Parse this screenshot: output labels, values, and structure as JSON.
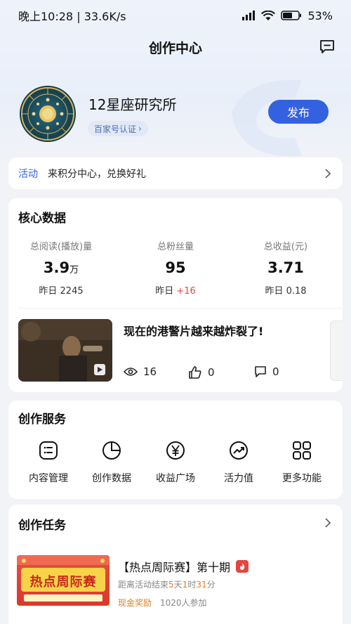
{
  "status_bar": {
    "time": "晚上10:28",
    "speed": "33.6K/s",
    "battery": "53"
  },
  "header": {
    "title": "创作中心"
  },
  "profile": {
    "name": "12星座研究所",
    "cert": "百家号认证",
    "publish": "发布"
  },
  "activity": {
    "tag": "活动",
    "text": "来积分中心，兑换好礼"
  },
  "core": {
    "title": "核心数据",
    "stats": [
      {
        "label": "总阅读(播放)量",
        "value": "3.9",
        "unit": "万",
        "sub_prefix": "昨日",
        "sub_value": "2245"
      },
      {
        "label": "总粉丝量",
        "value": "95",
        "unit": "",
        "sub_prefix": "昨日",
        "sub_value": "+16"
      },
      {
        "label": "总收益(元)",
        "value": "3.71",
        "unit": "",
        "sub_prefix": "昨日",
        "sub_value": "0.18"
      }
    ],
    "article": {
      "title": "现在的港警片越来越炸裂了!",
      "views": "16",
      "likes": "0",
      "comments": "0"
    }
  },
  "service": {
    "title": "创作服务",
    "items": [
      {
        "label": "内容管理",
        "icon": "list-icon"
      },
      {
        "label": "创作数据",
        "icon": "pie-chart-icon"
      },
      {
        "label": "收益广场",
        "icon": "yen-icon"
      },
      {
        "label": "活力值",
        "icon": "trend-icon"
      },
      {
        "label": "更多功能",
        "icon": "grid-icon"
      }
    ]
  },
  "task": {
    "title": "创作任务",
    "item_title": "【热点周际赛】第十期",
    "countdown_prefix": "距离活动结束",
    "days": "5",
    "days_unit": "天",
    "hours": "1",
    "hours_unit": "时",
    "minutes": "31",
    "minutes_unit": "分",
    "reward": "现金奖励",
    "joined": "1020人参加",
    "banner_text": "热点周际赛"
  },
  "colors": {
    "accent": "#3461e0",
    "up": "#e2463f",
    "reward": "#d9822b"
  }
}
